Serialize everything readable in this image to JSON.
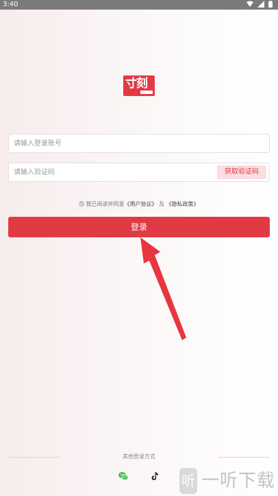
{
  "status_bar": {
    "time": "3:40"
  },
  "logo": {
    "text": "寸刻"
  },
  "login_form": {
    "account_placeholder": "请输入登录账号",
    "code_placeholder": "请输入验证码",
    "get_code_label": "获取验证码",
    "agree_prefix": "我已阅读并同意",
    "user_agreement": "《用户协议》",
    "and_text": "及",
    "privacy_policy": "《隐私政策》",
    "login_label": "登录"
  },
  "other_login": {
    "label": "其他登录方式",
    "options": [
      "wechat-icon",
      "douyin-icon"
    ]
  },
  "watermark": {
    "text": "一听下载",
    "badge": "听"
  },
  "colors": {
    "accent": "#e23a45",
    "accent_light": "#f9dfe1",
    "status_bar": "#7a7a7a"
  }
}
